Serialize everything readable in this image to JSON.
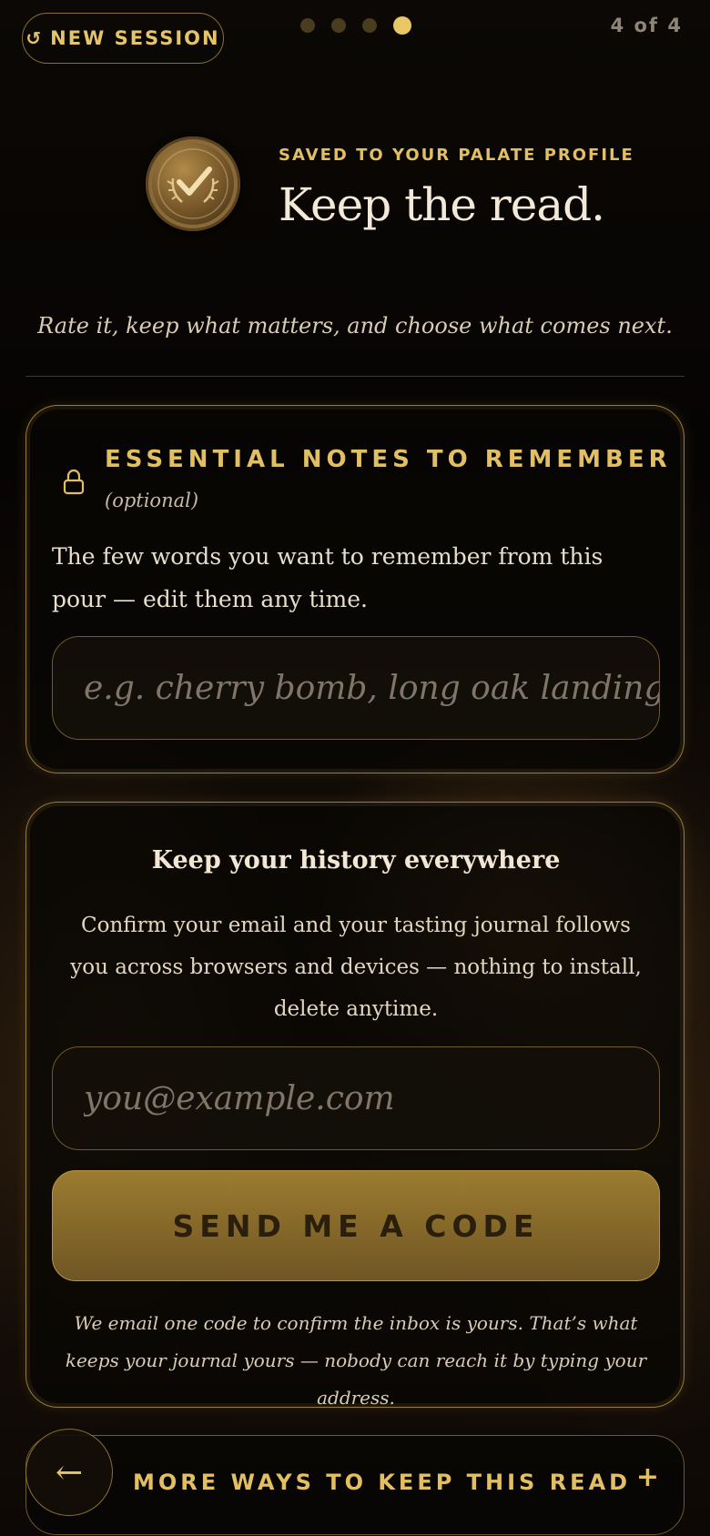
{
  "topbar": {
    "new_session_icon": "↺",
    "new_session_label": "NEW SESSION",
    "steps_total": 4,
    "steps_current": 4,
    "step_count": "4 of 4"
  },
  "header": {
    "medal_icon": "checkmark-laurel-medal",
    "eyebrow": "SAVED TO YOUR PALATE PROFILE",
    "title": "Keep the read.",
    "subtitle": "Rate it, keep what matters, and choose what comes next."
  },
  "notes": {
    "icon": "lock-icon",
    "label": "ESSENTIAL NOTES TO REMEMBER",
    "optional": "(optional)",
    "description": "The few words you want to remember from this pour — edit them any time.",
    "placeholder": "e.g. cherry bomb, long oak landing",
    "value": ""
  },
  "history": {
    "title": "Keep your history everywhere",
    "description": "Confirm your email and your tasting journal follows you across browsers and devices — nothing to install, delete anytime.",
    "email_placeholder": "you@example.com",
    "email_value": "",
    "send_label": "SEND ME A CODE",
    "fineprint": "We email one code to confirm the inbox is yours. That’s what keeps your journal yours — nobody can reach it by typing your address."
  },
  "footer": {
    "back_icon": "←",
    "more_label": "MORE WAYS TO KEEP THIS READ",
    "more_icon": "+"
  },
  "colors": {
    "accent_gold": "#e2bf63",
    "button_gold": "#8a6c2b",
    "background": "#050403",
    "text_cream": "#efe3cf"
  }
}
